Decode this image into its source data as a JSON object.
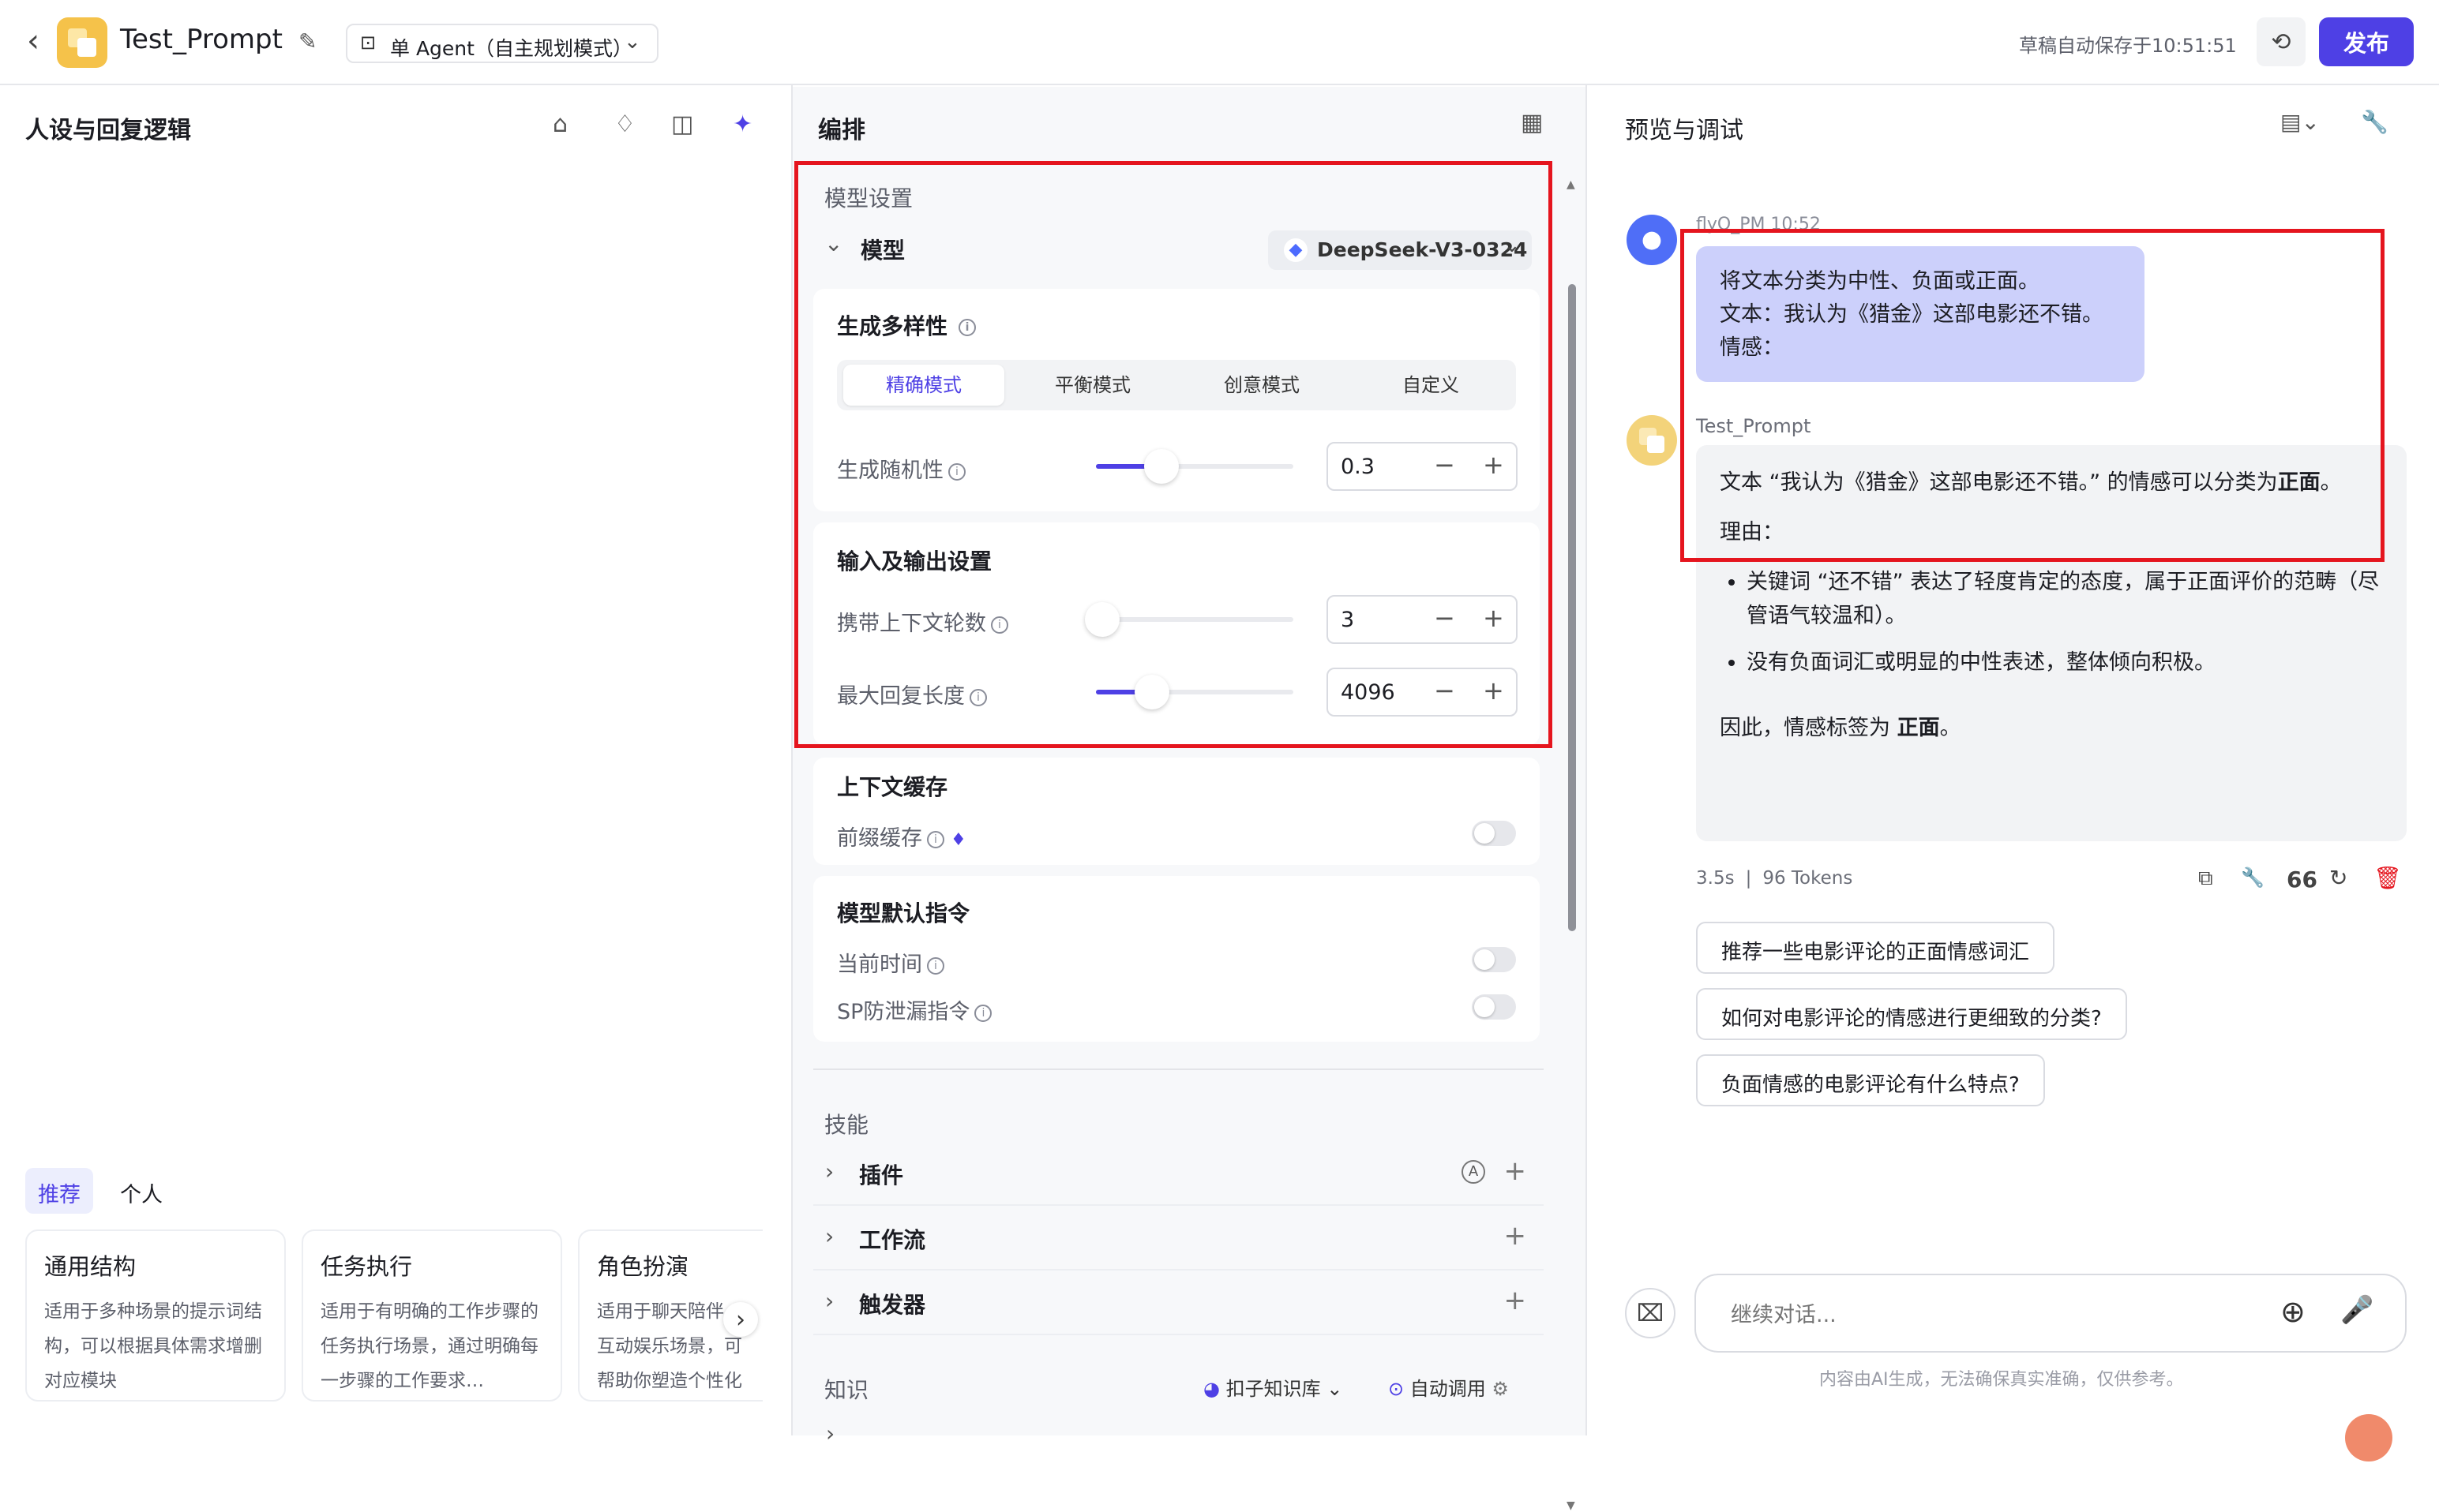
{
  "topbar": {
    "back_icon": "chevron-left-icon",
    "app_title": "Test_Prompt",
    "agent_mode": "单 Agent（自主规划模式）",
    "autosave": "草稿自动保存于10:51:51",
    "publish": "发布"
  },
  "left": {
    "title": "人设与回复逻辑",
    "tabs": [
      "推荐",
      "个人"
    ],
    "cards": [
      {
        "title": "通用结构",
        "desc": "适用于多种场景的提示词结构，可以根据具体需求增删对应模块"
      },
      {
        "title": "任务执行",
        "desc": "适用于有明确的工作步骤的任务执行场景，通过明确每一步骤的工作要求…"
      },
      {
        "title": "角色扮演",
        "desc": "适用于聊天陪伴、互动娱乐场景，可帮助你塑造个性化的人物角色"
      }
    ]
  },
  "middle": {
    "title": "编排",
    "model_settings": "模型设置",
    "model_label": "模型",
    "model_name": "DeepSeek-V3-0324",
    "diversity": {
      "title": "生成多样性",
      "modes": [
        "精确模式",
        "平衡模式",
        "创意模式",
        "自定义"
      ],
      "active_mode": "精确模式",
      "randomness_label": "生成随机性",
      "randomness_value": "0.3",
      "randomness_level": 0.3
    },
    "io": {
      "title": "输入及输出设置",
      "context_rounds_label": "携带上下文轮数",
      "context_rounds_value": "3",
      "context_rounds_level": 0.0,
      "max_length_label": "最大回复长度",
      "max_length_value": "4096",
      "max_length_level": 0.25
    },
    "context_cache": {
      "title": "上下文缓存",
      "prefix_label": "前缀缓存"
    },
    "default_instructions": {
      "title": "模型默认指令",
      "time_label": "当前时间",
      "sp_label": "SP防泄漏指令"
    },
    "skills": {
      "title": "技能",
      "rows": [
        "插件",
        "工作流",
        "触发器"
      ]
    },
    "knowledge": {
      "title": "知识",
      "kb": "扣子知识库",
      "auto": "自动调用"
    }
  },
  "right": {
    "title": "预览与调试",
    "user_meta": "flyQ_PM  10:52",
    "user_message": [
      "将文本分类为中性、负面或正面。",
      "文本：我认为《猎金》这部电影还不错。",
      "情感："
    ],
    "bot_name": "Test_Prompt",
    "bot_answer_lead": "文本 “我认为《猎金》这部电影还不错。” 的情感可以分类为",
    "bot_answer_bold": "正面",
    "bot_answer_end": "。",
    "reason_title": "理由：",
    "reasons": [
      "关键词 “还不错” 表达了轻度肯定的态度，属于正面评价的范畴（尽管语气较温和）。",
      "没有负面词汇或明显的中性表述，整体倾向积极。"
    ],
    "conclusion_lead": "因此，情感标签为 ",
    "conclusion_bold": "正面",
    "conclusion_end": "。",
    "time_used": "3.5s",
    "tokens": "96 Tokens",
    "suggestions": [
      "推荐一些电影评论的正面情感词汇",
      "如何对电影评论的情感进行更细致的分类?",
      "负面情感的电影评论有什么特点?"
    ],
    "input_placeholder": "继续对话...",
    "disclaimer": "内容由AI生成，无法确保真实准确，仅供参考。"
  },
  "colors": {
    "accent": "#4e40e5",
    "user_bubble": "#ccd0fb",
    "bot_bubble": "#f2f3f5",
    "highlight_box": "#e5151e",
    "danger": "#e5151e"
  }
}
